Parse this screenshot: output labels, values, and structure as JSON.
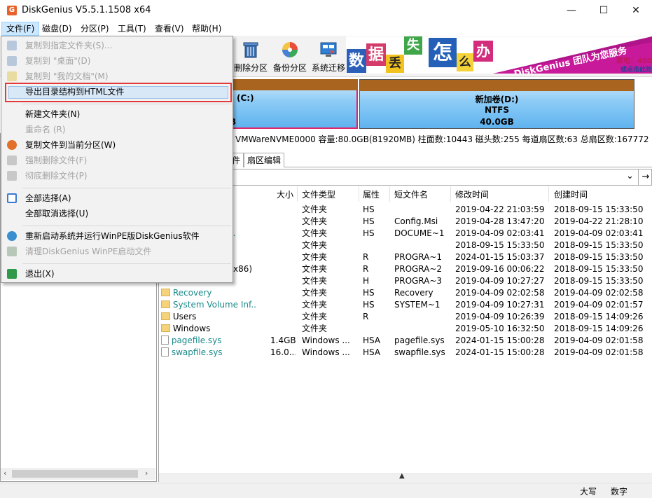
{
  "window": {
    "title": "DiskGenius V5.5.1.1508 x64",
    "icon_letter": "G",
    "minimize": "—",
    "maximize": "☐",
    "close": "✕"
  },
  "menubar": [
    "文件(F)",
    "磁盘(D)",
    "分区(P)",
    "工具(T)",
    "查看(V)",
    "帮助(H)"
  ],
  "toolbar": {
    "delete_partition": "删除分区",
    "backup_partition": "备份分区",
    "system_migration": "系统迁移"
  },
  "banner": {
    "chars": [
      "数",
      "据",
      "丢",
      "失",
      "怎",
      "么",
      "办"
    ],
    "slogan": "DiskGenius 团队为您服务",
    "phone_label": "致电：400",
    "click_label": "或点击此处"
  },
  "partitions": [
    {
      "name": "(C:)",
      "size": "B"
    },
    {
      "name": "新加卷(D:)",
      "fs": "NTFS",
      "size": "40.0GB"
    }
  ],
  "disk_info": "VMWareNVME0000  容量:80.0GB(81920MB)  柱面数:10443  磁头数:255  每道扇区数:63  总扇区数:167772",
  "tabs": [
    "件",
    "扇区编辑"
  ],
  "path_bar": {
    "arrow": "⌄",
    "go": "→"
  },
  "file_list": {
    "headers": [
      "大小",
      "文件类型",
      "属性",
      "短文件名",
      "修改时间",
      "创建时间"
    ],
    "rows": [
      {
        "name": "",
        "size": "",
        "type": "文件夹",
        "attr": "HS",
        "short": "",
        "modified": "2019-04-22 21:03:59",
        "created": "2018-09-15 15:33:50",
        "icon": "none"
      },
      {
        "name": "",
        "size": "",
        "type": "文件夹",
        "attr": "HS",
        "short": "Config.Msi",
        "modified": "2019-04-28 13:47:20",
        "created": "2019-04-22 21:28:10",
        "icon": "none"
      },
      {
        "name": "d S...",
        "size": "",
        "type": "文件夹",
        "attr": "HS",
        "short": "DOCUME~1",
        "modified": "2019-04-09 02:03:41",
        "created": "2019-04-09 02:03:41",
        "icon": "none",
        "teal": true
      },
      {
        "name": "",
        "size": "",
        "type": "文件夹",
        "attr": "",
        "short": "",
        "modified": "2018-09-15 15:33:50",
        "created": "2018-09-15 15:33:50",
        "icon": "none"
      },
      {
        "name": "",
        "size": "",
        "type": "文件夹",
        "attr": "R",
        "short": "PROGRA~1",
        "modified": "2024-01-15 15:03:37",
        "created": "2018-09-15 15:33:50",
        "icon": "none"
      },
      {
        "name": "x86)",
        "size": "",
        "type": "文件夹",
        "attr": "R",
        "short": "PROGRA~2",
        "modified": "2019-09-16 00:06:22",
        "created": "2018-09-15 15:33:50",
        "icon": "none"
      },
      {
        "name": "",
        "size": "",
        "type": "文件夹",
        "attr": "H",
        "short": "PROGRA~3",
        "modified": "2019-04-09 10:27:27",
        "created": "2018-09-15 15:33:50",
        "icon": "none"
      },
      {
        "name": "Recovery",
        "size": "",
        "type": "文件夹",
        "attr": "HS",
        "short": "Recovery",
        "modified": "2019-04-09 02:02:58",
        "created": "2019-04-09 02:02:58",
        "icon": "folder",
        "teal": true
      },
      {
        "name": "System Volume Inf...",
        "size": "",
        "type": "文件夹",
        "attr": "HS",
        "short": "SYSTEM~1",
        "modified": "2019-04-09 10:27:31",
        "created": "2019-04-09 02:01:57",
        "icon": "folder",
        "teal": true
      },
      {
        "name": "Users",
        "size": "",
        "type": "文件夹",
        "attr": "R",
        "short": "",
        "modified": "2019-04-09 10:26:39",
        "created": "2018-09-15 14:09:26",
        "icon": "folder"
      },
      {
        "name": "Windows",
        "size": "",
        "type": "文件夹",
        "attr": "",
        "short": "",
        "modified": "2019-05-10 16:32:50",
        "created": "2018-09-15 14:09:26",
        "icon": "folder"
      },
      {
        "name": "pagefile.sys",
        "size": "1.4GB",
        "type": "Windows ...",
        "attr": "HSA",
        "short": "pagefile.sys",
        "modified": "2024-01-15 15:00:28",
        "created": "2019-04-09 02:01:58",
        "icon": "file",
        "teal": true
      },
      {
        "name": "swapfile.sys",
        "size": "16.0...",
        "type": "Windows ...",
        "attr": "HSA",
        "short": "swapfile.sys",
        "modified": "2024-01-15 15:00:28",
        "created": "2019-04-09 02:01:58",
        "icon": "file",
        "teal": true
      }
    ]
  },
  "file_menu": {
    "items": [
      {
        "label": "复制到指定文件夹(S)...",
        "disabled": true,
        "icon": "copy-to-folder-icon",
        "color": "#b8c8dc"
      },
      {
        "label": "复制到 \"桌面\"(D)",
        "disabled": true,
        "icon": "desktop-icon",
        "color": "#b8c8dc"
      },
      {
        "label": "复制到 \"我的文档\"(M)",
        "disabled": true,
        "icon": "documents-icon",
        "color": "#e8dca0"
      },
      {
        "label": "导出目录结构到HTML文件",
        "disabled": false,
        "highlighted": true
      },
      {
        "label": "新建文件夹(N)",
        "disabled": false
      },
      {
        "label": "重命名 (R)",
        "disabled": true
      },
      {
        "label": "复制文件到当前分区(W)",
        "disabled": false,
        "icon": "copy-partition-icon",
        "color": "#e0702a"
      },
      {
        "label": "强制删除文件(F)",
        "disabled": true,
        "icon": "force-delete-icon",
        "color": "#c8c8c8"
      },
      {
        "label": "彻底删除文件(P)",
        "disabled": true,
        "icon": "shred-icon",
        "color": "#c8c8c8"
      },
      {
        "label": "全部选择(A)",
        "disabled": false,
        "icon": "check-icon",
        "color": "#3a7bd5"
      },
      {
        "label": "全部取消选择(U)",
        "disabled": false
      },
      {
        "label": "重新启动系统并运行WinPE版DiskGenius软件",
        "disabled": false,
        "icon": "gear-icon",
        "color": "#3a8fd0"
      },
      {
        "label": "清理DiskGenius WinPE启动文件",
        "disabled": true,
        "icon": "clean-icon",
        "color": "#b8c8b8"
      },
      {
        "label": "退出(X)",
        "disabled": false,
        "icon": "exit-icon",
        "color": "#2e9a4a"
      }
    ]
  },
  "statusbar": {
    "caps": "大写",
    "num": "数字"
  }
}
